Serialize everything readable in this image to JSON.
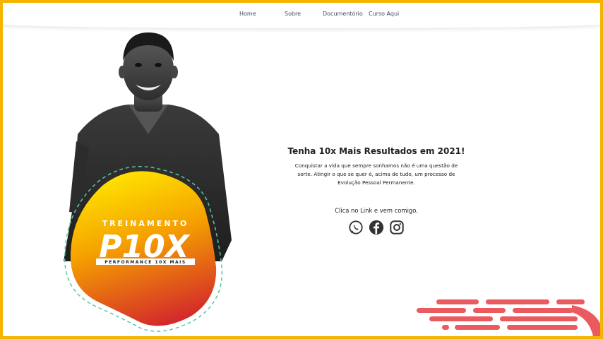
{
  "nav": {
    "items": [
      {
        "label": "Home"
      },
      {
        "label": "Sobre"
      },
      {
        "label": "Documentório"
      },
      {
        "label": "Curso Aqui"
      }
    ]
  },
  "badge": {
    "kicker": "TREINAMENTO",
    "title": "P10X",
    "subtitle": "PERFORMANCE 10X MAIS"
  },
  "content": {
    "headline": "Tenha 10x Mais Resultados em 2021!",
    "lead": "Conquistar a vida que sempre sonhamos não é uma questão de sorte. Atingir o que se quer é, acima de tudo, um processo de Evolução Pessoal Permanente.",
    "cta": "Clica no Link e vem comigo."
  },
  "social": [
    {
      "icon": "whatsapp-icon"
    },
    {
      "icon": "facebook-icon"
    },
    {
      "icon": "instagram-icon"
    }
  ],
  "colors": {
    "frame": "#f5b400",
    "badge_top": "#ffe600",
    "badge_bottom": "#d42a2a",
    "decor": "#ea5a5f",
    "nav_text": "#3d4a63"
  }
}
